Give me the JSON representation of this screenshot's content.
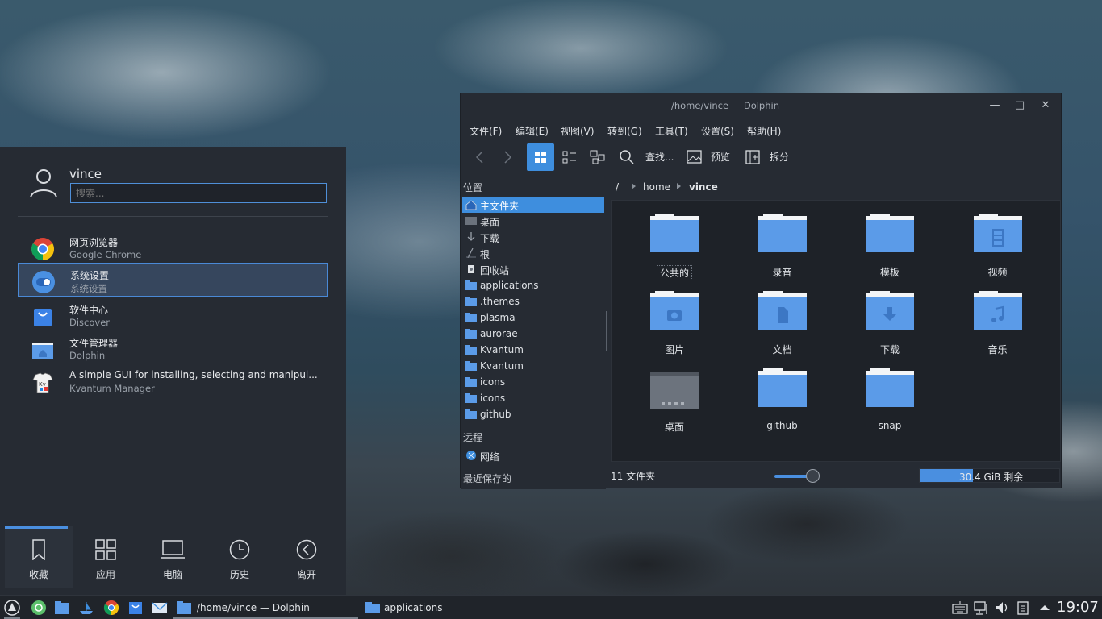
{
  "launcher": {
    "user_name": "vince",
    "search_placeholder": "搜索...",
    "apps": [
      {
        "title": "网页浏览器",
        "subtitle": "Google Chrome",
        "icon": "chrome-icon"
      },
      {
        "title": "系统设置",
        "subtitle": "系统设置",
        "icon": "settings-toggle-icon"
      },
      {
        "title": "软件中心",
        "subtitle": "Discover",
        "icon": "discover-bag-icon"
      },
      {
        "title": "文件管理器",
        "subtitle": "Dolphin",
        "icon": "folder-home-icon"
      },
      {
        "title": "A simple GUI for installing, selecting and manipul...",
        "subtitle": "Kvantum Manager",
        "icon": "kvantum-icon"
      }
    ],
    "tabs": [
      "收藏",
      "应用",
      "电脑",
      "历史",
      "离开"
    ]
  },
  "dolphin": {
    "title": "/home/vince — Dolphin",
    "menu": [
      "文件(F)",
      "编辑(E)",
      "视图(V)",
      "转到(G)",
      "工具(T)",
      "设置(S)",
      "帮助(H)"
    ],
    "toolbar": {
      "find": "查找...",
      "preview": "预览",
      "split": "拆分"
    },
    "places_heading": "位置",
    "places": [
      "主文件夹",
      "桌面",
      "下载",
      "根",
      "回收站",
      "applications",
      ".themes",
      "plasma",
      "aurorae",
      "Kvantum",
      "Kvantum",
      "icons",
      "icons",
      "github"
    ],
    "remote_heading": "远程",
    "network": "网络",
    "recent_heading": "最近保存的",
    "breadcrumb": [
      "/",
      "home",
      "vince"
    ],
    "folders": [
      "公共的",
      "录音",
      "模板",
      "视频",
      "图片",
      "文档",
      "下载",
      "音乐",
      "桌面",
      "github",
      "snap"
    ],
    "status_count": "11 文件夹",
    "free_space": "30.4 GiB 剩余",
    "zoom_level": 0.8,
    "used_fraction": 0.38
  },
  "taskbar": {
    "tasks": [
      "/home/vince — Dolphin",
      "applications"
    ],
    "clock": "19:07"
  },
  "colors": {
    "accent": "#3e8ede",
    "folder": "#5b9be8",
    "panel": "#262b33"
  }
}
